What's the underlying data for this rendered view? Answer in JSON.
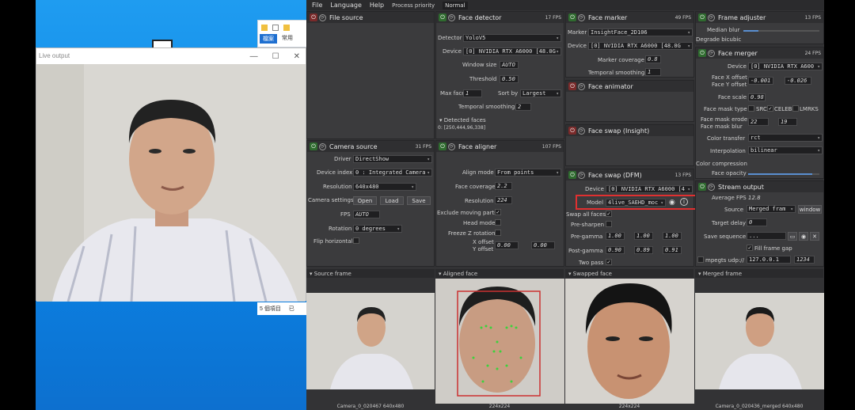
{
  "desktop": {
    "explorer_tab1": "檔案",
    "explorer_tab2": "常用",
    "explorer_items": "5 個項目",
    "explorer_sel": "已"
  },
  "live": {
    "title": "Live output",
    "min": "—",
    "max": "☐",
    "close": "✕"
  },
  "menu": {
    "file": "File",
    "language": "Language",
    "help": "Help",
    "priority_label": "Process priority",
    "priority_value": "Normal"
  },
  "file_source": {
    "title": "File source"
  },
  "face_detector": {
    "title": "Face detector",
    "fps": "17 FPS",
    "detector_label": "Detector",
    "detector": "YoloV5",
    "device_label": "Device",
    "device": "[0] NVIDIA RTX A6000 [48.0G",
    "window_label": "Window size",
    "window": "AUTO",
    "threshold_label": "Threshold",
    "threshold": "0.50",
    "maxfaces_label": "Max faces",
    "maxfaces": "1",
    "sortby_label": "Sort by",
    "sortby": "Largest",
    "temporal_label": "Temporal smoothing",
    "temporal": "2",
    "detected_label": "Detected faces",
    "detected_value": "0: [250,444,96,338]"
  },
  "face_marker": {
    "title": "Face marker",
    "fps": "49 FPS",
    "marker_label": "Marker",
    "marker": "InsightFace_2D106",
    "device_label": "Device",
    "device": "[0] NVIDIA RTX A6000 [48.0G",
    "coverage_label": "Marker coverage",
    "coverage": "0.8",
    "temporal_label": "Temporal smoothing",
    "temporal": "1"
  },
  "face_animator": {
    "title": "Face animator"
  },
  "face_swap_insight": {
    "title": "Face swap (Insight)"
  },
  "face_swap_dfm": {
    "title": "Face swap (DFM)",
    "fps": "13 FPS",
    "device_label": "Device",
    "device": "[0] NVIDIA RTX A6000 [4",
    "model_label": "Model",
    "model": "4live_SAEHD_moc",
    "swap_all_label": "Swap all faces",
    "presharpen_label": "Pre-sharpen",
    "pregamma_label": "Pre-gamma",
    "pre_r": "1.00",
    "pre_g": "1.00",
    "pre_b": "1.00",
    "postgamma_label": "Post-gamma",
    "post_r": "0.90",
    "post_g": "0.89",
    "post_b": "0.91",
    "twopass_label": "Two pass"
  },
  "camera_source": {
    "title": "Camera source",
    "fps": "31 FPS",
    "driver_label": "Driver",
    "driver": "DirectShow",
    "device_label": "Device index",
    "device": "0 : Integrated Camera",
    "res_label": "Resolution",
    "res": "640x480",
    "settings_label": "Camera settings",
    "open": "Open",
    "load": "Load",
    "save": "Save",
    "fps_label": "FPS",
    "fps_value": "AUTO",
    "rotation_label": "Rotation",
    "rotation": "0 degrees",
    "flip_label": "Flip horizontal"
  },
  "face_aligner": {
    "title": "Face aligner",
    "fps": "107 FPS",
    "mode_label": "Align mode",
    "mode": "From points",
    "coverage_label": "Face coverage",
    "coverage": "2.2",
    "res_label": "Resolution",
    "res": "224",
    "exclude_label": "Exclude moving parts",
    "head_label": "Head mode",
    "freeze_label": "Freeze Z rotation",
    "xoff_label": "X offset",
    "yoff_label": "Y offset",
    "xoff": "0.00",
    "yoff": "0.00"
  },
  "frame_adjuster": {
    "title": "Frame adjuster",
    "fps": "13 FPS",
    "median_label": "Median blur",
    "degrade_label": "Degrade bicubic",
    "median_level": 0.2
  },
  "face_merger": {
    "title": "Face merger",
    "fps": "24 FPS",
    "device_label": "Device",
    "device": "[0] NVIDIA RTX A600",
    "xoff_label": "Face X offset",
    "yoff_label": "Face Y offset",
    "xoff": "-0.001",
    "yoff": "-0.026",
    "scale_label": "Face scale",
    "scale": "0.98",
    "masktype_label": "Face mask type",
    "src": "SRC",
    "celeb": "CELEB",
    "lmrks": "LMRKS",
    "erode_label": "Face mask erode",
    "blur_label": "Face mask blur",
    "erode": "22",
    "blur": "19",
    "transfer_label": "Color transfer",
    "transfer": "rct",
    "interp_label": "Interpolation",
    "interp": "bilinear",
    "compress_label": "Color compression",
    "opacity_label": "Face opacity",
    "opacity_level": 0.9
  },
  "stream_output": {
    "title": "Stream output",
    "avgfps_label": "Average FPS",
    "avgfps": "12.8",
    "source_label": "Source",
    "source": "Merged fram",
    "window": "window",
    "delay_label": "Target delay",
    "delay": "0",
    "saveseq_label": "Save sequence",
    "saveseq": "...",
    "fillgap_label": "Fill frame gap",
    "mpegts_label": "mpegts udp://",
    "ip": "127.0.0.1",
    "port": "1234"
  },
  "viewers": {
    "source": "Source frame",
    "aligned": "Aligned face",
    "swapped": "Swapped face",
    "merged": "Merged frame",
    "cap_source": "Camera_0_020467 640x480",
    "cap_aligned": "224x224",
    "cap_swapped": "224x224",
    "cap_merged": "Camera_0_020436_merged 640x480"
  }
}
